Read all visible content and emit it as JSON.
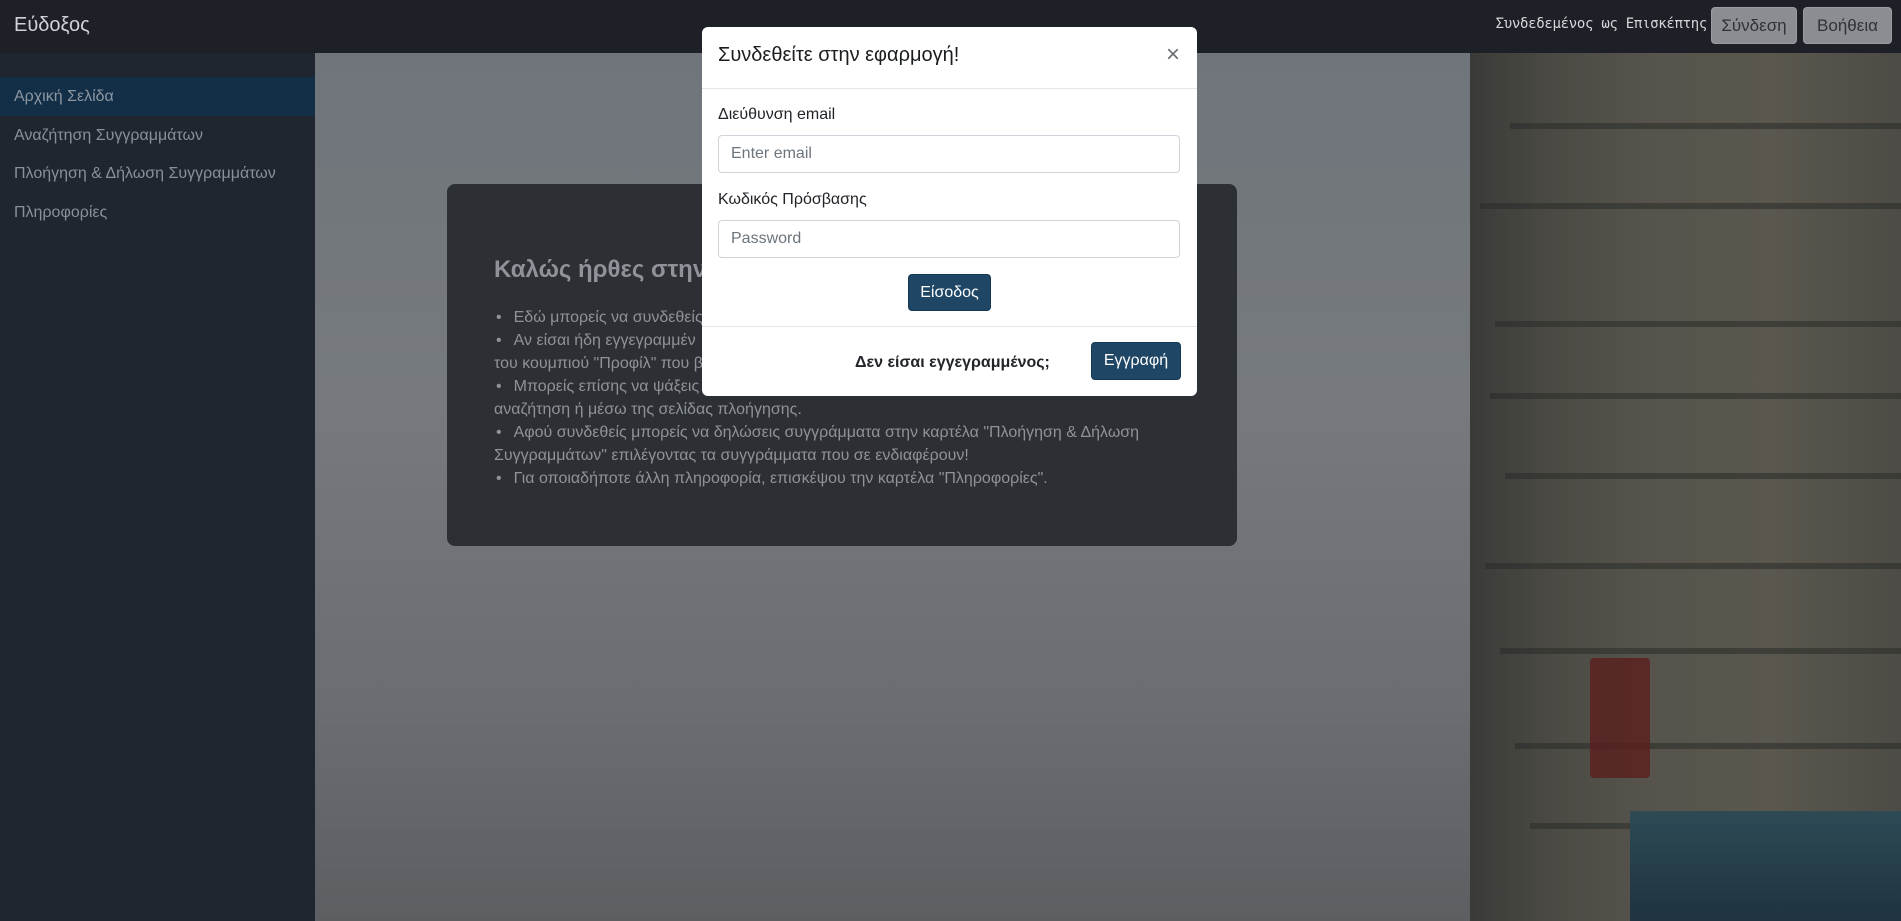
{
  "navbar": {
    "brand": "Εύδοξος",
    "user_status": "Συνδεδεμένος ως Επισκέπτης",
    "login_label": "Σύνδεση",
    "help_label": "Βοήθεια"
  },
  "sidebar": {
    "items": [
      {
        "label": "Αρχική Σελίδα",
        "active": true
      },
      {
        "label": "Αναζήτηση Συγγραμμάτων",
        "active": false
      },
      {
        "label": "Πλοήγηση & Δήλωση Συγγραμμάτων",
        "active": false
      },
      {
        "label": "Πληροφορίες",
        "active": false
      }
    ]
  },
  "welcome": {
    "title": "Καλώς ήρθες στην",
    "bullets": [
      "Εδώ μπορείς να συνδεθείς",
      "Αν είσαι ήδη εγγεγραμμέν",
      "του κουμπιού \"Προφίλ\" που β",
      "Μπορείς επίσης να ψάξεις για συγγράμματα στην βάση συγγραμμάτων πατώντας",
      "αναζήτηση ή μέσω της σελίδας πλοήγησης.",
      "Αφού συνδεθείς μπορείς να δηλώσεις συγγράμματα στην καρτέλα \"Πλοήγηση & Δήλωση",
      "Συγγραμμάτων\" επιλέγοντας τα συγγράμματα που σε ενδιαφέρουν!",
      "Για οποιαδήποτε άλλη πληροφορία, επισκέψου την καρτέλα \"Πληροφορίες\"."
    ]
  },
  "modal": {
    "title": "Συνδεθείτε στην εφαρμογή!",
    "close": "×",
    "email_label": "Διεύθυνση email",
    "email_placeholder": "Enter email",
    "password_label": "Κωδικός Πρόσβασης",
    "password_placeholder": "Password",
    "submit_label": "Είσοδος",
    "footer_text": "Δεν είσαι εγγεγραμμένος;",
    "register_label": "Εγγραφή"
  },
  "colors": {
    "navbar": "#1d2027",
    "sidebar": "#1f2630",
    "sidebar_active": "#122f47",
    "primary_button": "#1f4664"
  }
}
